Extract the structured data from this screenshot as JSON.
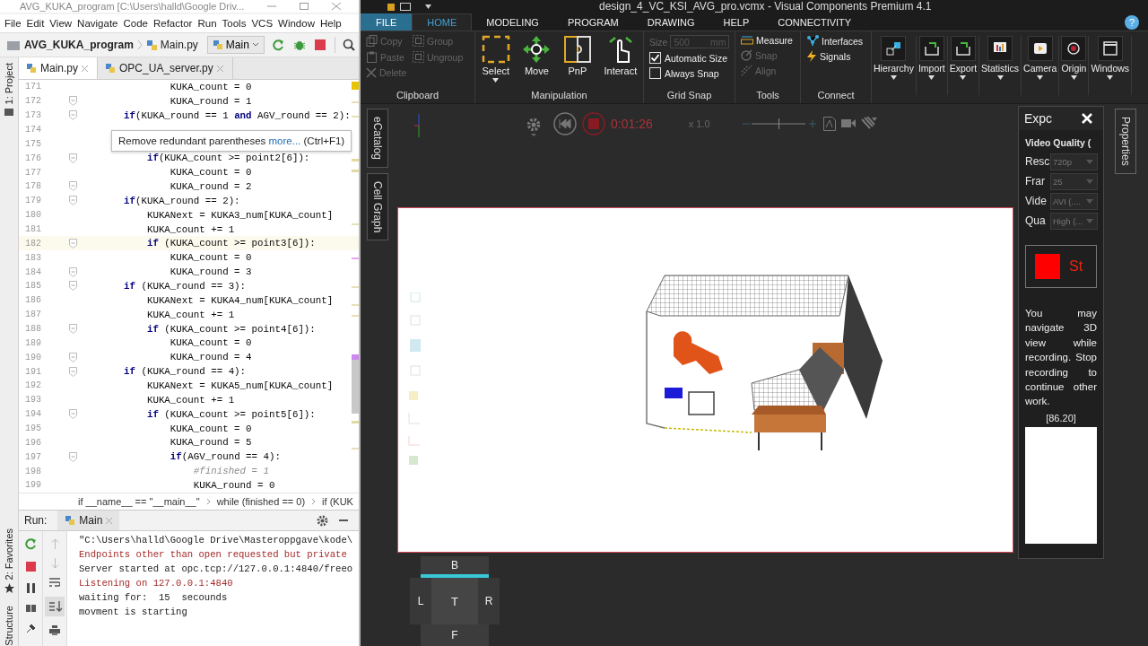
{
  "ide": {
    "title": "AVG_KUKA_program [C:\\Users\\halld\\Google Driv...",
    "menu": [
      "File",
      "Edit",
      "View",
      "Navigate",
      "Code",
      "Refactor",
      "Run",
      "Tools",
      "VCS",
      "Window",
      "Help"
    ],
    "project": "AVG_KUKA_program",
    "file": "Main.py",
    "run_config": "Main",
    "tabs": [
      {
        "label": "Main.py",
        "selected": true
      },
      {
        "label": "OPC_UA_server.py",
        "selected": false
      }
    ],
    "side_tabs": [
      "1: Project",
      "2: Favorites",
      "Structure"
    ],
    "code": [
      {
        "num": "171",
        "code": "        KUKA_count = 0",
        "fold": false,
        "current": false,
        "kind": "code"
      },
      {
        "num": "172",
        "code": "        KUKA_round = 1",
        "fold": true,
        "current": false,
        "kind": "code"
      },
      {
        "num": "173",
        "code": "**if**(KUKA_round == 1 **and** AGV_round == 2):",
        "fold": true,
        "current": false,
        "kind": "code"
      },
      {
        "num": "174",
        "fold": false,
        "current": false
      },
      {
        "num": "175",
        "fold": false,
        "current": false
      },
      {
        "num": "176",
        "code": "    **if**(KUKA_count >= point2[6]):",
        "fold": true,
        "current": false,
        "kind": "code"
      },
      {
        "num": "177",
        "code": "        KUKA_count = 0",
        "fold": false,
        "current": false,
        "kind": "code"
      },
      {
        "num": "178",
        "code": "        KUKA_round = 2",
        "fold": true,
        "current": false,
        "kind": "code"
      },
      {
        "num": "179",
        "code": "**if**(KUKA_round == 2):",
        "fold": true,
        "current": false,
        "kind": "code"
      },
      {
        "num": "180",
        "code": "    KUKANext = KUKA3_num[KUKA_count]",
        "fold": false,
        "current": false,
        "kind": "code"
      },
      {
        "num": "181",
        "code": "    KUKA_count += 1",
        "fold": false,
        "current": false,
        "kind": "code"
      },
      {
        "num": "182",
        "code": "    **if** (KUKA_count >= point3[6]):",
        "fold": true,
        "current": true,
        "kind": "code"
      },
      {
        "num": "183",
        "code": "        KUKA_count = 0",
        "fold": false,
        "current": false,
        "kind": "code"
      },
      {
        "num": "184",
        "code": "        KUKA_round = 3",
        "fold": true,
        "current": false,
        "kind": "code"
      },
      {
        "num": "185",
        "code": "**if** (KUKA_round == 3):",
        "fold": true,
        "current": false,
        "kind": "code"
      },
      {
        "num": "186",
        "code": "    KUKANext = KUKA4_num[KUKA_count]",
        "fold": false,
        "current": false,
        "kind": "code"
      },
      {
        "num": "187",
        "code": "    KUKA_count += 1",
        "fold": false,
        "current": false,
        "kind": "code"
      },
      {
        "num": "188",
        "code": "    **if** (KUKA_count >= point4[6]):",
        "fold": true,
        "current": false,
        "kind": "code"
      },
      {
        "num": "189",
        "code": "        KUKA_count = 0",
        "fold": false,
        "current": false,
        "kind": "code"
      },
      {
        "num": "190",
        "code": "        KUKA_round = 4",
        "fold": true,
        "current": false,
        "kind": "code"
      },
      {
        "num": "191",
        "code": "**if** (KUKA_round == 4):",
        "fold": true,
        "current": false,
        "kind": "code"
      },
      {
        "num": "192",
        "code": "    KUKANext = KUKA5_num[KUKA_count]",
        "fold": false,
        "current": false,
        "kind": "code"
      },
      {
        "num": "193",
        "code": "    KUKA_count += 1",
        "fold": false,
        "current": false,
        "kind": "code"
      },
      {
        "num": "194",
        "code": "    **if** (KUKA_count >= point5[6]):",
        "fold": true,
        "current": false,
        "kind": "code"
      },
      {
        "num": "195",
        "code": "        KUKA_count = 0",
        "fold": false,
        "current": false,
        "kind": "code"
      },
      {
        "num": "196",
        "code": "        KUKA_round = 5",
        "fold": false,
        "current": false,
        "kind": "code"
      },
      {
        "num": "197",
        "code": "        **if**(AGV_round == 4):",
        "fold": true,
        "current": false,
        "kind": "code"
      },
      {
        "num": "198",
        "code": "            #finished = 1",
        "fold": false,
        "current": false,
        "kind": "comment"
      },
      {
        "num": "199",
        "code": "            KUKA_round = 0",
        "fold": false,
        "current": false,
        "kind": "code"
      }
    ],
    "hint": {
      "text": "Remove redundant parentheses",
      "link": "more...",
      "shortcut": "(Ctrl+F1)"
    },
    "breadcrumbs": [
      "if __name__ == \"__main__\"",
      "while (finished == 0)",
      "if (KUK"
    ],
    "run": {
      "label": "Run:",
      "tab": "Main",
      "console": [
        {
          "text": "\"C:\\Users\\halld\\Google Drive\\Masteroppgave\\kode\\",
          "kind": "normal"
        },
        {
          "text": "Endpoints other than open requested but private",
          "kind": "error"
        },
        {
          "text": "Server started at opc.tcp://127.0.0.1:4840/freeo",
          "kind": "normal"
        },
        {
          "text": "Listening on 127.0.0.1:4840",
          "kind": "error"
        },
        {
          "text": "waiting for:  15  secounds",
          "kind": "normal"
        },
        {
          "text": "movment is starting",
          "kind": "normal"
        }
      ]
    }
  },
  "app": {
    "title": "design_4_VC_KSI_AVG_pro.vcmx - Visual Components Premium 4.1",
    "tabs": [
      {
        "label": "FILE",
        "kind": "file",
        "selected": false
      },
      {
        "label": "HOME",
        "kind": "tab",
        "selected": true
      },
      {
        "label": "MODELING",
        "kind": "tab",
        "selected": false
      },
      {
        "label": "PROGRAM",
        "kind": "tab",
        "selected": false
      },
      {
        "label": "DRAWING",
        "kind": "tab",
        "selected": false
      },
      {
        "label": "HELP",
        "kind": "tab",
        "selected": false
      },
      {
        "label": "CONNECTIVITY",
        "kind": "tab",
        "selected": false
      }
    ],
    "help": "?",
    "clipboard": {
      "title": "Clipboard",
      "items": [
        {
          "label": "Copy",
          "kind": "copy",
          "disabled": true
        },
        {
          "label": "Group",
          "kind": "group",
          "disabled": true
        },
        {
          "label": "Paste",
          "kind": "paste",
          "disabled": true
        },
        {
          "label": "Ungroup",
          "kind": "ungroup",
          "disabled": true
        },
        {
          "label": "Delete",
          "kind": "delete",
          "disabled": true
        }
      ]
    },
    "manipulation": {
      "title": "Manipulation",
      "items": [
        {
          "label": "Select",
          "kind": "select"
        },
        {
          "label": "Move",
          "kind": "move"
        },
        {
          "label": "PnP",
          "kind": "pnp"
        },
        {
          "label": "Interact",
          "kind": "interact"
        }
      ]
    },
    "grid_snap": {
      "title": "Grid Snap",
      "size_label": "Size",
      "size_value": "500",
      "unit": "mm",
      "checks": [
        {
          "label": "Automatic Size",
          "checked": true
        },
        {
          "label": "Always Snap",
          "checked": false
        }
      ]
    },
    "tools": {
      "title": "Tools",
      "items": [
        {
          "label": "Measure",
          "kind": "measure",
          "disabled": false
        },
        {
          "label": "Snap",
          "kind": "snap",
          "disabled": true
        },
        {
          "label": "Align",
          "kind": "align",
          "disabled": true
        }
      ]
    },
    "connect": {
      "title": "Connect",
      "items": [
        {
          "label": "Interfaces",
          "kind": "interfaces"
        },
        {
          "label": "Signals",
          "kind": "signals"
        }
      ]
    },
    "big_buttons": [
      {
        "label": "Hierarchy",
        "kind": "hierarchy"
      },
      {
        "label": "Import",
        "kind": "import"
      },
      {
        "label": "Export",
        "kind": "export"
      },
      {
        "label": "Statistics",
        "kind": "statistics"
      },
      {
        "label": "Camera",
        "kind": "camera"
      },
      {
        "label": "Origin",
        "kind": "origin"
      },
      {
        "label": "Windows",
        "kind": "windows"
      }
    ],
    "side_tabs": [
      "eCatalog",
      "Cell Graph"
    ],
    "playback": {
      "time": "0:01:26",
      "speed": "x 1.0",
      "level": 0.5
    },
    "nav_cube": {
      "top": "B",
      "center": "T",
      "left": "L",
      "right": "R",
      "bottom": "F"
    },
    "export_panel": {
      "title": "Expc",
      "section": "Video Quality (",
      "fields": [
        {
          "label": "Resc",
          "value": "720p"
        },
        {
          "label": "Frar",
          "value": "25"
        },
        {
          "label": "Vide",
          "value": "AVI (...."
        },
        {
          "label": "Qua",
          "value": "High (..."
        }
      ],
      "stop": "St",
      "note": "You may navigate 3D view while recording. Stop recording to continue other work.",
      "counter": "[86.20]"
    },
    "properties_tab": "Properties"
  }
}
